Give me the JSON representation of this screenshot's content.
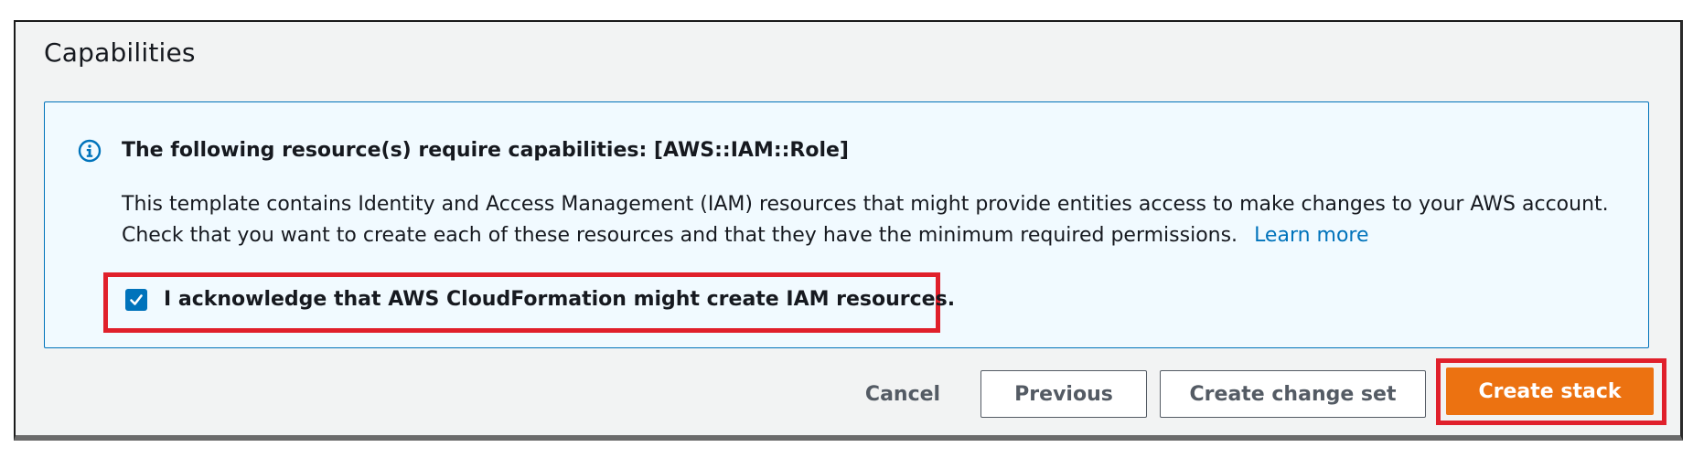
{
  "section": {
    "title": "Capabilities"
  },
  "alert": {
    "icon": "info-icon",
    "accent_color": "#0073bb",
    "background_color": "#f1faff",
    "heading": "The following resource(s) require capabilities: [AWS::IAM::Role]",
    "body": "This template contains Identity and Access Management (IAM) resources that might provide entities access to make changes to your AWS account. Check that you want to create each of these resources and that they have the minimum required permissions.",
    "learn_more": "Learn more"
  },
  "acknowledge": {
    "checked": true,
    "label": "I acknowledge that AWS CloudFormation might create IAM resources.",
    "icon": "checkmark-icon"
  },
  "actions": {
    "cancel": "Cancel",
    "previous": "Previous",
    "create_change_set": "Create change set",
    "create_stack": "Create stack",
    "primary_color": "#ec7211",
    "highlight_color": "#e0202b"
  }
}
